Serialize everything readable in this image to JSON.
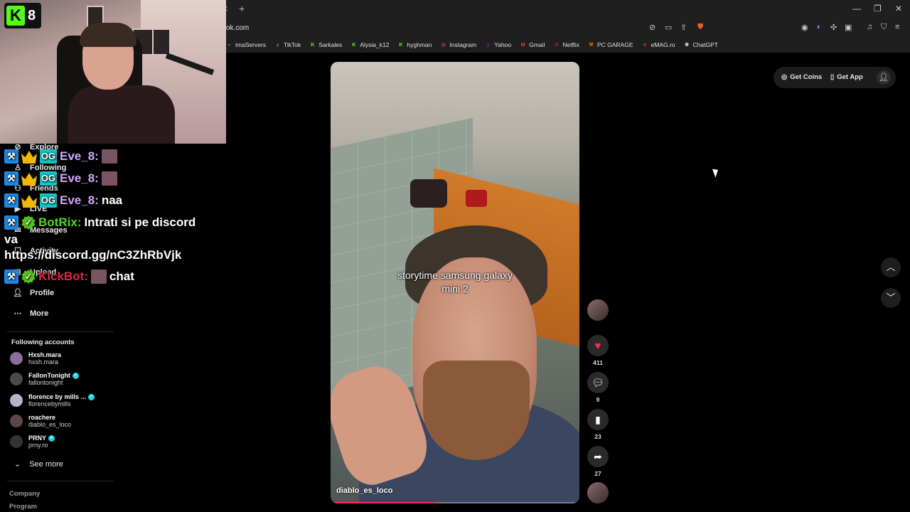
{
  "browser": {
    "url": "ok.com",
    "bookmarks": [
      {
        "label": "imaServers",
        "icon": "server-icon",
        "color": "#3fa9f5"
      },
      {
        "label": "TikTok",
        "icon": "tiktok-icon",
        "color": "#ffffff"
      },
      {
        "label": "Sarkales",
        "icon": "kick-icon",
        "color": "#53fc18"
      },
      {
        "label": "Alysia_k12",
        "icon": "kick-icon",
        "color": "#53fc18"
      },
      {
        "label": "hyghman",
        "icon": "kick-icon",
        "color": "#53fc18"
      },
      {
        "label": "Instagram",
        "icon": "instagram-icon",
        "color": "#e1306c"
      },
      {
        "label": "Yahoo",
        "icon": "yahoo-icon",
        "color": "#7b1fa2"
      },
      {
        "label": "Gmail",
        "icon": "gmail-icon",
        "color": "#ea4335"
      },
      {
        "label": "Netflix",
        "icon": "netflix-icon",
        "color": "#e50914"
      },
      {
        "label": "PC GARAGE",
        "icon": "wrench-icon",
        "color": "#f57c00"
      },
      {
        "label": "eMAG.ro",
        "icon": "emag-icon",
        "color": "#e53935"
      },
      {
        "label": "ChatGPT",
        "icon": "chatgpt-icon",
        "color": "#bdbdbd"
      }
    ]
  },
  "stream": {
    "logo_number": "8"
  },
  "sidebar": {
    "nav": [
      {
        "label": "Explore",
        "icon": "compass-icon"
      },
      {
        "label": "Following",
        "icon": "following-icon"
      },
      {
        "label": "Friends",
        "icon": "friends-icon"
      },
      {
        "label": "LIVE",
        "icon": "live-icon"
      },
      {
        "label": "Messages",
        "icon": "messages-icon"
      },
      {
        "label": "Activity",
        "icon": "activity-icon"
      },
      {
        "label": "Upload",
        "icon": "upload-icon"
      },
      {
        "label": "Profile",
        "icon": "profile-icon"
      },
      {
        "label": "More",
        "icon": "more-icon"
      }
    ],
    "following_title": "Following accounts",
    "accounts": [
      {
        "name": "Hxsh.mara",
        "user": "hxsh.mara",
        "verified": false
      },
      {
        "name": "FallonTonight",
        "user": "fallontonight",
        "verified": true
      },
      {
        "name": "florence by mills ...",
        "user": "florencebymills",
        "verified": true
      },
      {
        "name": "roachere",
        "user": "diablo_es_loco",
        "verified": false
      },
      {
        "name": "PRNY",
        "user": "prny.ro",
        "verified": true
      }
    ],
    "see_more": "See more",
    "footer": [
      "Company",
      "Program"
    ]
  },
  "chat": {
    "messages": [
      {
        "user": "Eve_8:",
        "text": ""
      },
      {
        "user": "Eve_8:",
        "text": ""
      },
      {
        "user": "Eve_8:",
        "text": "naa"
      },
      {
        "user": "BotRix:",
        "text": "Intrati si pe discord"
      },
      {
        "user": "",
        "text": "va"
      },
      {
        "user": "",
        "text": "https://discord.gg/nC3ZhRbVjk"
      },
      {
        "user": "KickBot:",
        "text": "chat"
      }
    ]
  },
  "video": {
    "caption_line1": "storytime samsung galaxy",
    "caption_line2": "mini 2",
    "author": "diablo_es_loco",
    "progress": 0.43
  },
  "actions": {
    "likes": "411",
    "comments": "9",
    "saves": "23",
    "shares": "27"
  },
  "topbar": {
    "get_coins": "Get Coins",
    "get_app": "Get App"
  }
}
